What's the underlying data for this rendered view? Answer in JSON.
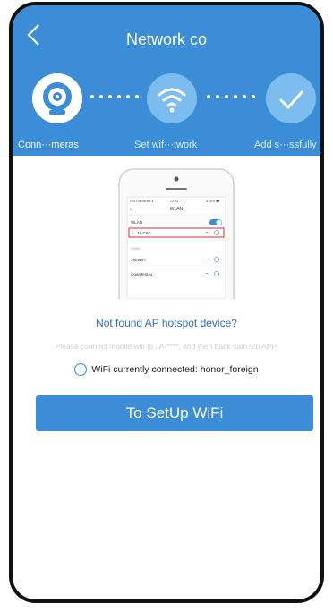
{
  "header": {
    "title": "Network co",
    "steps": [
      {
        "label": "Conn···meras",
        "icon": "camera-icon"
      },
      {
        "label": "Set wif···twork",
        "icon": "wifi-icon"
      },
      {
        "label": "Add s···ssfully",
        "icon": "checkmark-icon"
      }
    ]
  },
  "illustration": {
    "status": "Full  Full Wirele ●",
    "time": "12:34",
    "battery": "● 78% ■■",
    "screen_title": "WLAN",
    "wlan_label": "WLAN",
    "selected_network": "JA-C6C",
    "section_label": "SSIDS",
    "network_1": "360WiFi",
    "network_2": "jooanTest.iu"
  },
  "content": {
    "not_found_title": "Not found AP hotspot device?",
    "instruction": "Please connect mobile wifi to JA-****, and then back cam720 APP.",
    "wifi_connected_label": "WiFi currently connected:",
    "wifi_connected_value": "honor_foreign"
  },
  "actions": {
    "setup_button": "To SetUp WiFi"
  },
  "colors": {
    "primary": "#3a8dd6",
    "step_inactive": "#7dbcee",
    "link_blue": "#2f6fc3",
    "highlight_red": "#d23030"
  }
}
